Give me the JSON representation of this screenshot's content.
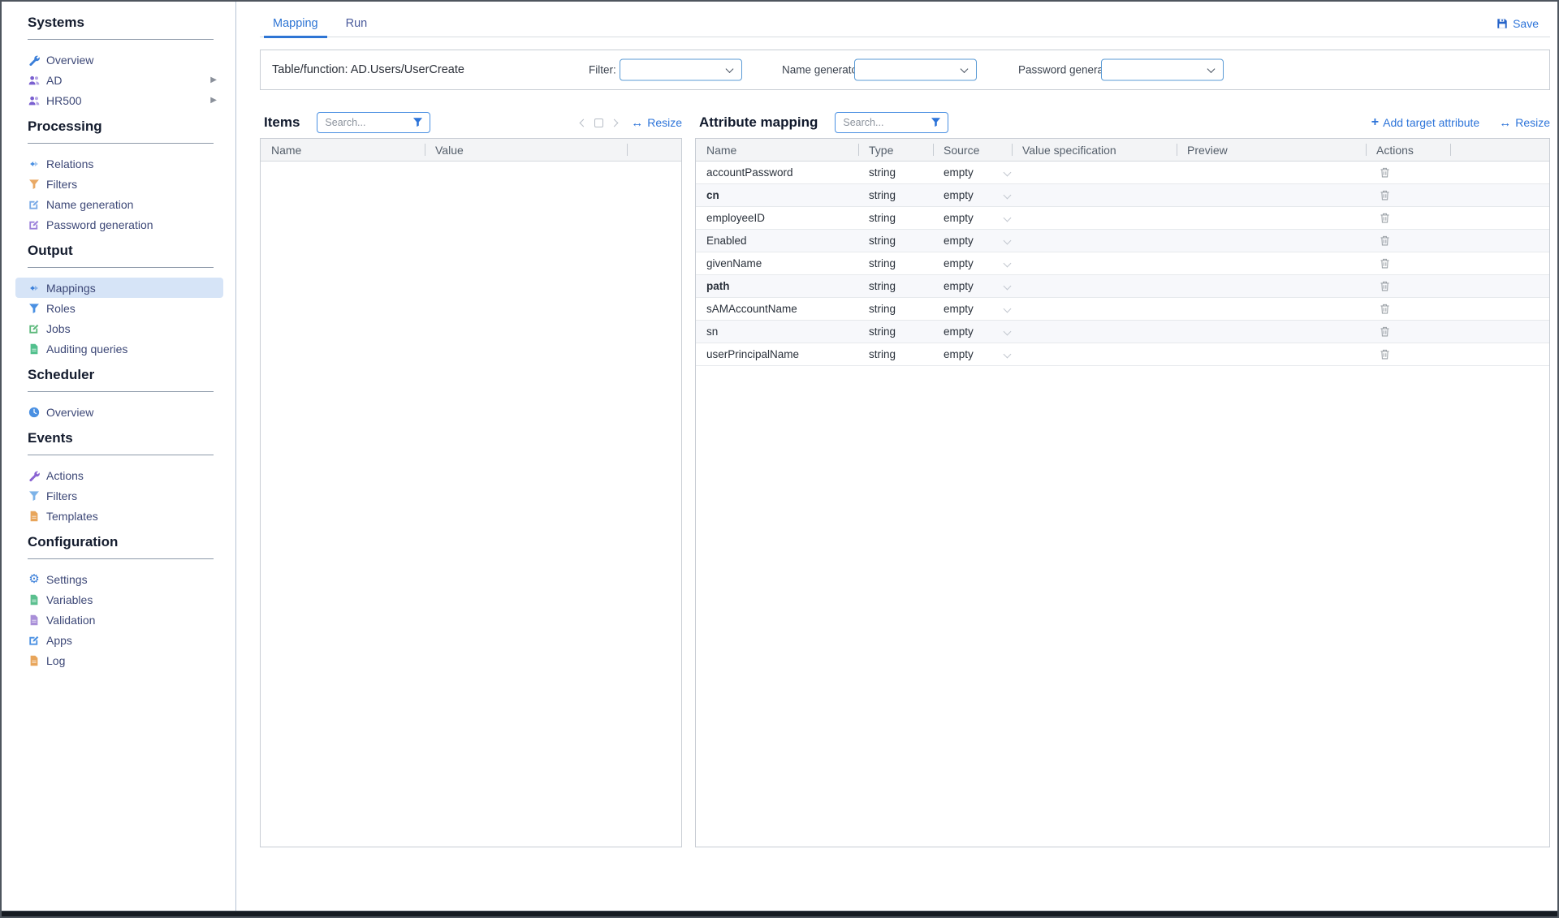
{
  "colors": {
    "accent_blue": "#2d74d9",
    "tab_active": "#2e75d4",
    "selected_row_bg": "#d6e4f7",
    "combo_border": "#5b9bd5",
    "table_border": "#c8cdd4"
  },
  "sidebar": {
    "sections": [
      {
        "title": "Systems",
        "items": [
          {
            "label": "Overview",
            "icon": "wrench-icon",
            "icon_style": "color:#3b7fd9"
          },
          {
            "label": "AD",
            "icon": "users-icon",
            "icon_style": "color:#7a5fd0",
            "expandable": true
          },
          {
            "label": "HR500",
            "icon": "users-icon",
            "icon_style": "color:#7a5fd0",
            "expandable": true
          }
        ]
      },
      {
        "title": "Processing",
        "items": [
          {
            "label": "Relations",
            "icon": "arrows-icon",
            "icon_style": "color:#4a90e2"
          },
          {
            "label": "Filters",
            "icon": "funnel-icon",
            "icon_style": "color:#e9a965"
          },
          {
            "label": "Name generation",
            "icon": "edit-icon",
            "icon_style": "color:#79a9e6"
          },
          {
            "label": "Password generation",
            "icon": "edit-icon",
            "icon_style": "color:#9b80da"
          }
        ]
      },
      {
        "title": "Output",
        "items": [
          {
            "label": "Mappings",
            "icon": "arrows-icon",
            "icon_style": "color:#3b7fd9",
            "selected": true
          },
          {
            "label": "Roles",
            "icon": "funnel-icon",
            "icon_style": "color:#4a90e2"
          },
          {
            "label": "Jobs",
            "icon": "edit-icon",
            "icon_style": "color:#5cb87a"
          },
          {
            "label": "Auditing queries",
            "icon": "document-icon",
            "icon_style": "color:#52c08d"
          }
        ]
      },
      {
        "title": "Scheduler",
        "items": [
          {
            "label": "Overview",
            "icon": "clock-icon",
            "icon_style": "color:#4a90e2"
          }
        ]
      },
      {
        "title": "Events",
        "items": [
          {
            "label": "Actions",
            "icon": "wrench-icon",
            "icon_style": "color:#8a63d2"
          },
          {
            "label": "Filters",
            "icon": "funnel-icon",
            "icon_style": "color:#7db3e8"
          },
          {
            "label": "Templates",
            "icon": "document-icon",
            "icon_style": "color:#e8a55a"
          }
        ]
      },
      {
        "title": "Configuration",
        "items": [
          {
            "label": "Settings",
            "icon": "gear-icon",
            "icon_style": "color:#3b7fd9"
          },
          {
            "label": "Variables",
            "icon": "document-icon",
            "icon_style": "color:#5abf8e"
          },
          {
            "label": "Validation",
            "icon": "document-icon",
            "icon_style": "color:#a98fd8"
          },
          {
            "label": "Apps",
            "icon": "edit-icon",
            "icon_style": "color:#4a90e2"
          },
          {
            "label": "Log",
            "icon": "document-icon",
            "icon_style": "color:#e8a55a"
          }
        ]
      }
    ]
  },
  "tabs": [
    {
      "label": "Mapping",
      "active": true
    },
    {
      "label": "Run",
      "active": false
    }
  ],
  "save_label": "Save",
  "toolbar": {
    "table_function": "Table/function: AD.Users/UserCreate",
    "filter_label": "Filter:",
    "filter_value": "",
    "name_generator_label": "Name generator:",
    "name_generator_value": "",
    "password_generator_label": "Password generator:",
    "password_generator_value": ""
  },
  "items_panel": {
    "title": "Items",
    "search_placeholder": "Search...",
    "resize_label": "Resize",
    "columns": [
      "Name",
      "Value"
    ],
    "rows": []
  },
  "attribute_panel": {
    "title": "Attribute mapping",
    "search_placeholder": "Search...",
    "add_label": "Add target attribute",
    "resize_label": "Resize",
    "columns": [
      "Name",
      "Type",
      "Source",
      "Value specification",
      "Preview",
      "Actions"
    ],
    "rows": [
      {
        "name": "accountPassword",
        "type": "string",
        "source": "empty"
      },
      {
        "name": "cn",
        "type": "string",
        "source": "empty",
        "bold": true
      },
      {
        "name": "employeeID",
        "type": "string",
        "source": "empty"
      },
      {
        "name": "Enabled",
        "type": "string",
        "source": "empty"
      },
      {
        "name": "givenName",
        "type": "string",
        "source": "empty"
      },
      {
        "name": "path",
        "type": "string",
        "source": "empty",
        "bold": true
      },
      {
        "name": "sAMAccountName",
        "type": "string",
        "source": "empty"
      },
      {
        "name": "sn",
        "type": "string",
        "source": "empty"
      },
      {
        "name": "userPrincipalName",
        "type": "string",
        "source": "empty"
      }
    ]
  }
}
